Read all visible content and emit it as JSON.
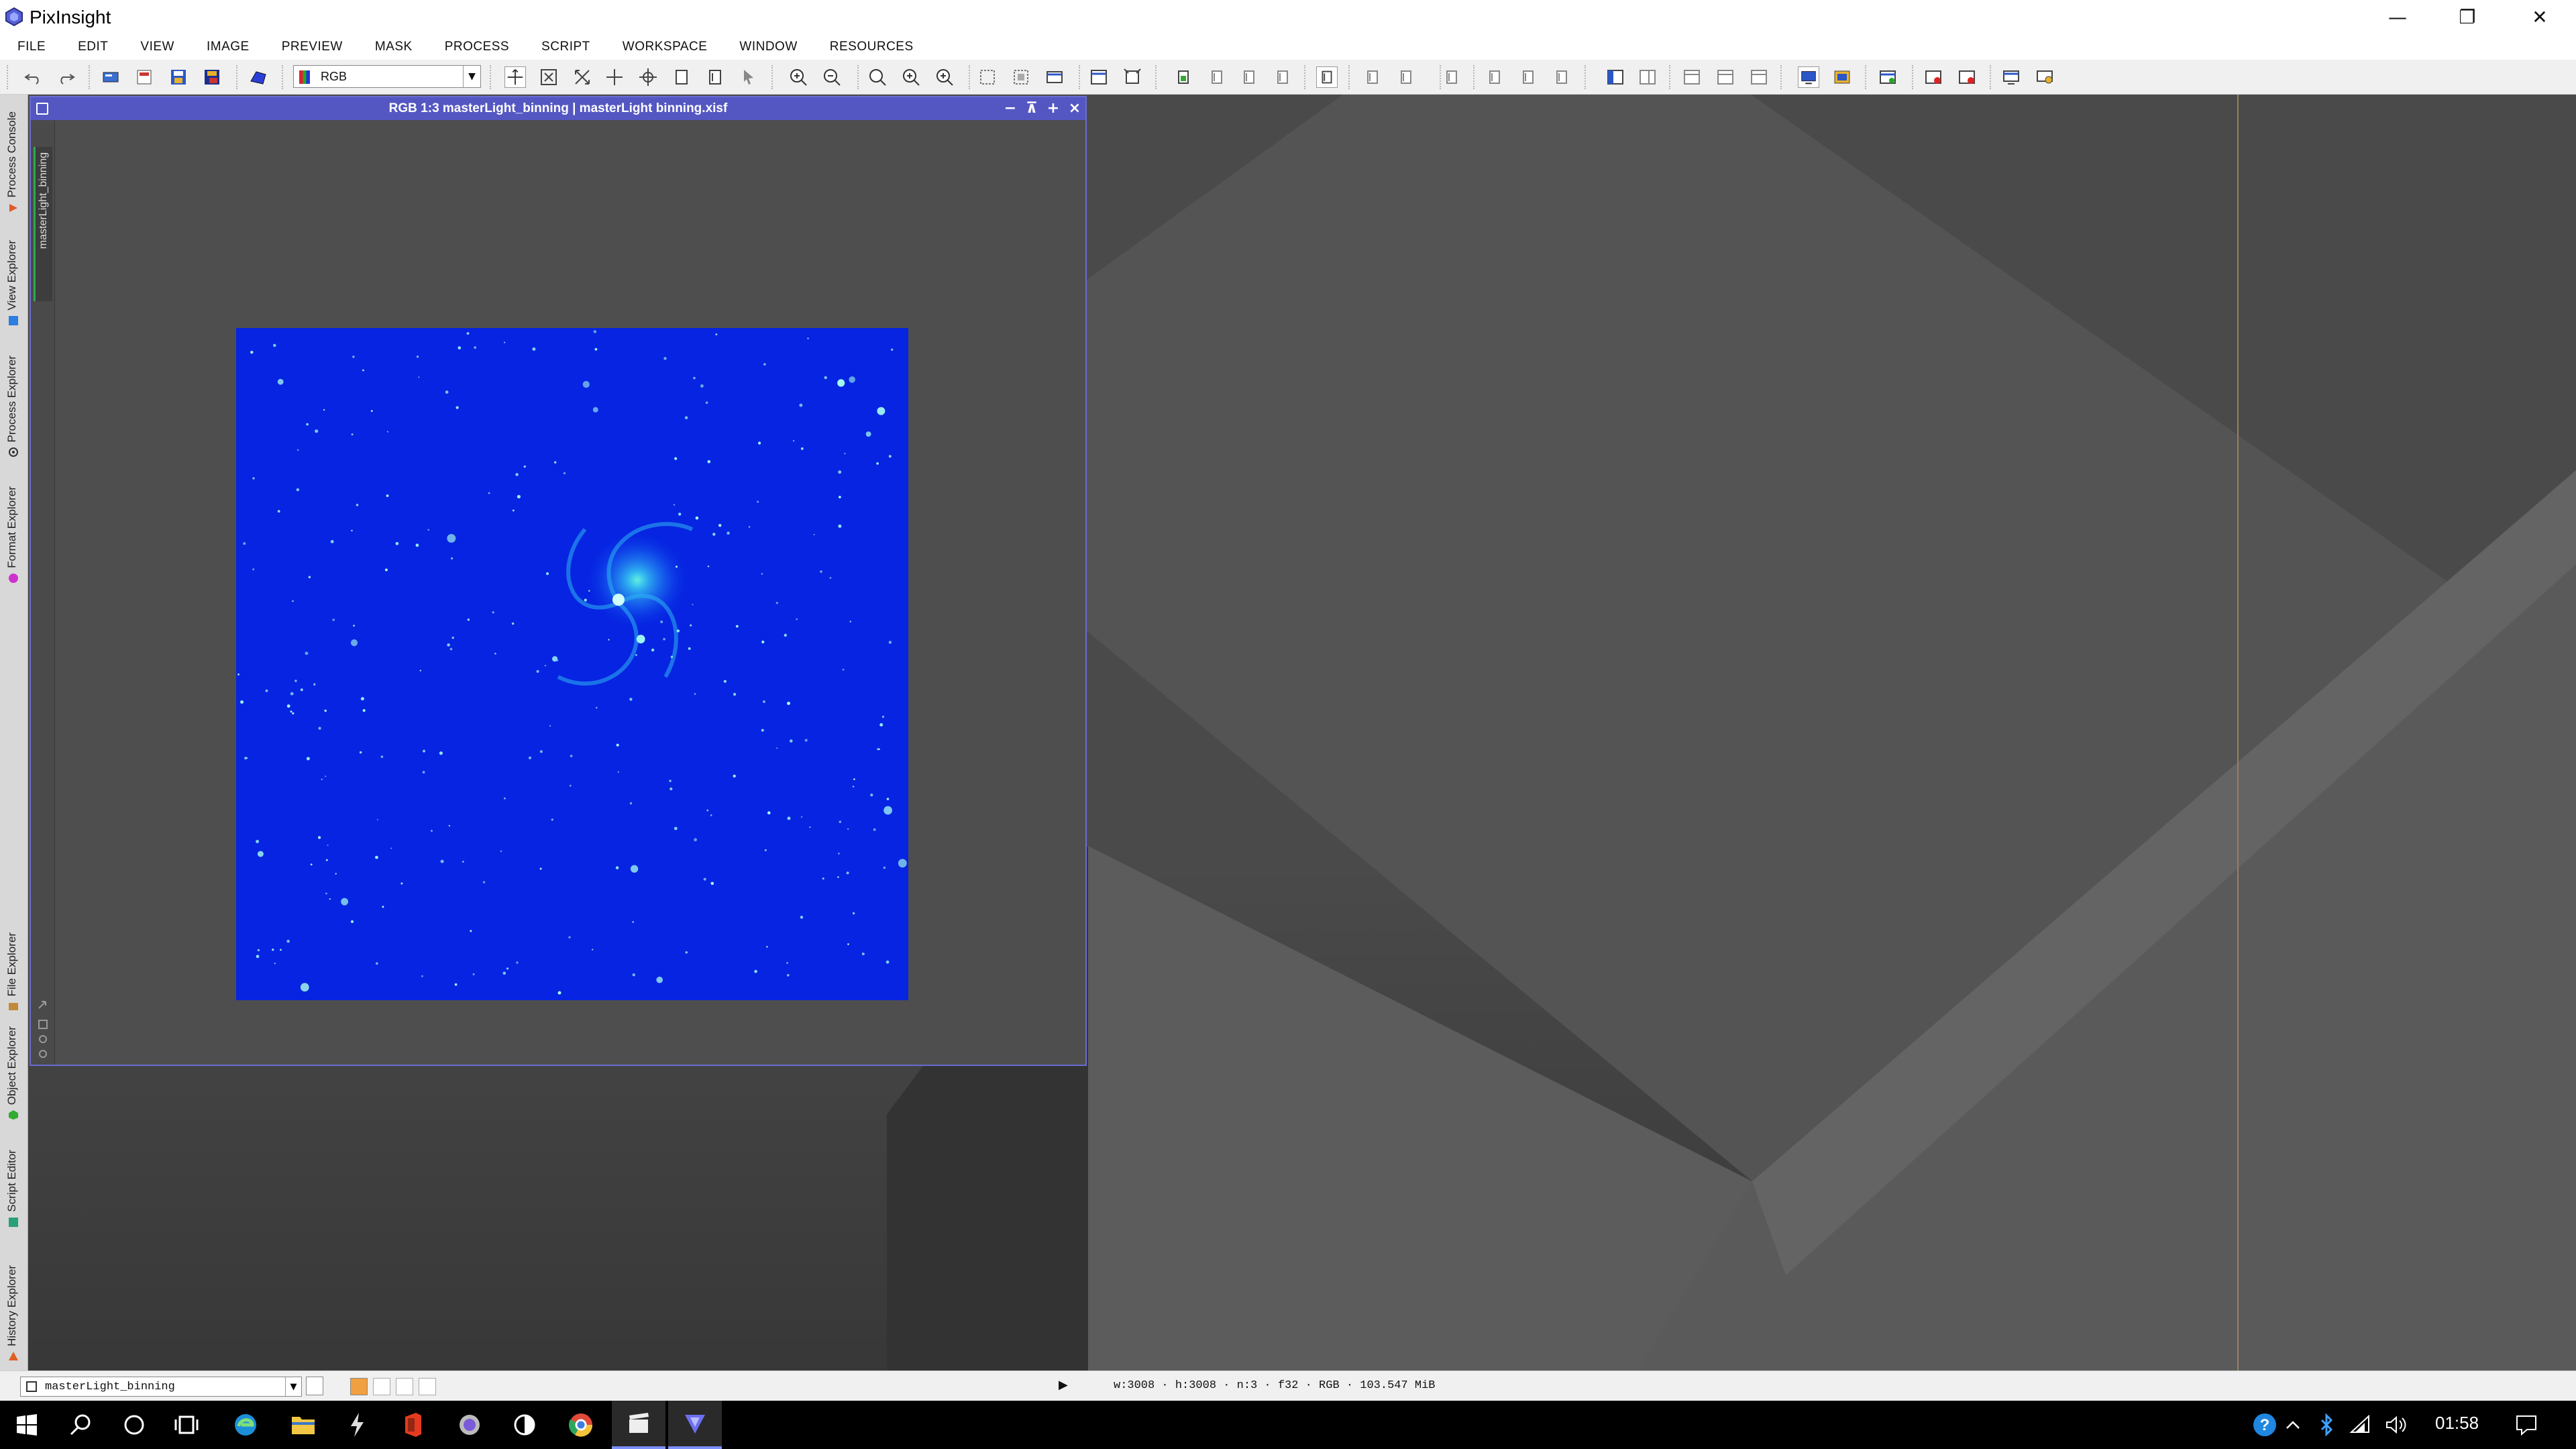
{
  "app": {
    "title": "PixInsight"
  },
  "window_controls": {
    "minimize": "—",
    "restore": "❐",
    "close": "✕"
  },
  "menu": [
    "FILE",
    "EDIT",
    "VIEW",
    "IMAGE",
    "PREVIEW",
    "MASK",
    "PROCESS",
    "SCRIPT",
    "WORKSPACE",
    "WINDOW",
    "RESOURCES"
  ],
  "toolbar": {
    "color_mode": "RGB"
  },
  "left_tabs": [
    {
      "label": "Process Console",
      "icon": "process-console-icon",
      "color": "#e05a2a"
    },
    {
      "label": "View Explorer",
      "icon": "view-explorer-icon",
      "color": "#2b7de0"
    },
    {
      "label": "Process Explorer",
      "icon": "process-explorer-icon",
      "color": "#333333"
    },
    {
      "label": "Format Explorer",
      "icon": "format-explorer-icon",
      "color": "#cc33cc"
    },
    {
      "label": "File Explorer",
      "icon": "file-explorer-icon",
      "color": "#c08a3a"
    },
    {
      "label": "Object Explorer",
      "icon": "object-explorer-icon",
      "color": "#33aa33"
    },
    {
      "label": "Script Editor",
      "icon": "script-editor-icon",
      "color": "#2aa07a"
    },
    {
      "label": "History Explorer",
      "icon": "history-explorer-icon",
      "color": "#e06020"
    }
  ],
  "image_window": {
    "title": "RGB 1:3 masterLight_binning | masterLight binning.xisf",
    "view_tab": "masterLight_binning"
  },
  "statusbar": {
    "view_id": "masterLight_binning",
    "image_info": "w:3008 · h:3008 · n:3 · f32 · RGB · 103.547 MiB"
  },
  "taskbar": {
    "time": "01:58"
  },
  "colors": {
    "title_bar_accent": "#5457c2",
    "image_background": "#0420e0",
    "workspace": "#4a4a4a"
  }
}
